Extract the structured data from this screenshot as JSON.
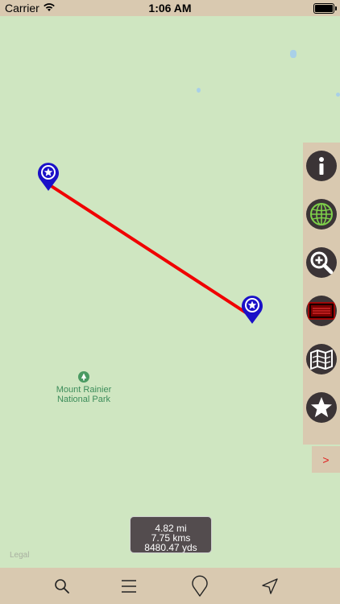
{
  "status_bar": {
    "carrier": "Carrier",
    "time": "1:06 AM",
    "wifi_icon": "wifi-icon",
    "battery_level": 1.0
  },
  "map": {
    "poi_label_line1": "Mount Rainier",
    "poi_label_line2": "National Park",
    "legal": "Legal",
    "route_color": "#f00000",
    "pin_color": "#1a10c8"
  },
  "sidebar": {
    "buttons": [
      {
        "icon": "info-icon"
      },
      {
        "icon": "globe-icon"
      },
      {
        "icon": "zoom-in-icon"
      },
      {
        "icon": "tv-icon"
      },
      {
        "icon": "folded-map-icon"
      },
      {
        "icon": "star-icon"
      }
    ],
    "expand_label": ">"
  },
  "distance": {
    "miles": "4.82 mi",
    "kms": "7.75 kms",
    "yards": "8480.47 yds"
  },
  "tab_bar": {
    "items": [
      {
        "icon": "search-icon"
      },
      {
        "icon": "list-icon"
      },
      {
        "icon": "pin-icon"
      },
      {
        "icon": "location-arrow-icon"
      }
    ]
  },
  "colors": {
    "panel": "#d9c9b0",
    "map_background": "#cfe6c1",
    "button_dark": "#3b3436",
    "expand_arrow": "#e01b1b"
  }
}
